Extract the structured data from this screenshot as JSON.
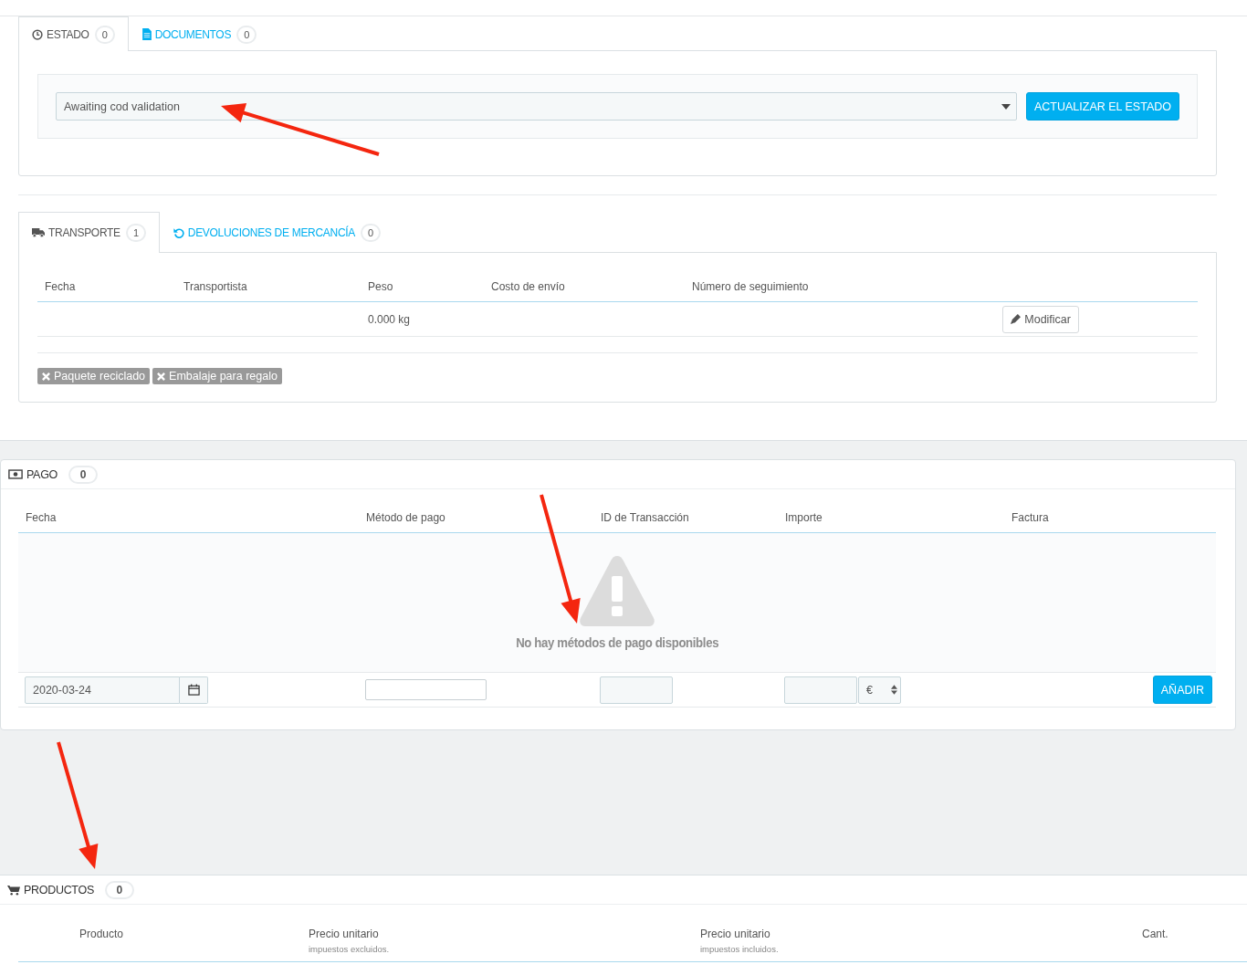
{
  "status_panel": {
    "tabs": [
      {
        "label": "ESTADO",
        "count": "0",
        "kind": "status",
        "selected": true
      },
      {
        "label": "DOCUMENTOS",
        "count": "0",
        "kind": "documents",
        "selected": false
      }
    ],
    "status_select": {
      "value": "Awaiting cod validation"
    },
    "update_button": "ACTUALIZAR EL ESTADO"
  },
  "shipping_panel": {
    "tabs": [
      {
        "label": "TRANSPORTE",
        "count": "1",
        "kind": "shipping",
        "selected": true
      },
      {
        "label": "DEVOLUCIONES DE MERCANCÍA",
        "count": "0",
        "kind": "returns",
        "selected": false
      }
    ],
    "columns": [
      "Fecha",
      "Transportista",
      "Peso",
      "Costo de envío",
      "Número de seguimiento"
    ],
    "rows": [
      {
        "weight": "0.000 kg",
        "action_button": "Modificar"
      }
    ],
    "tags": [
      {
        "label": "Paquete reciclado",
        "checked": false
      },
      {
        "label": "Embalaje para regalo",
        "checked": false
      }
    ]
  },
  "payment_panel": {
    "title": "PAGO",
    "count": "0",
    "columns": [
      "Fecha",
      "Método de pago",
      "ID de Transacción",
      "Importe",
      "Factura"
    ],
    "empty_message": "No hay métodos de pago disponibles",
    "form": {
      "date": "2020-03-24",
      "currency": "€",
      "add_button": "AÑADIR"
    }
  },
  "products_panel": {
    "title": "PRODUCTOS",
    "count": "0",
    "columns": [
      {
        "label": "Producto"
      },
      {
        "label": "Precio unitario",
        "note": "impuestos excluidos."
      },
      {
        "label": "Precio unitario",
        "note": "impuestos incluidos."
      },
      {
        "label": "Cant."
      }
    ]
  }
}
